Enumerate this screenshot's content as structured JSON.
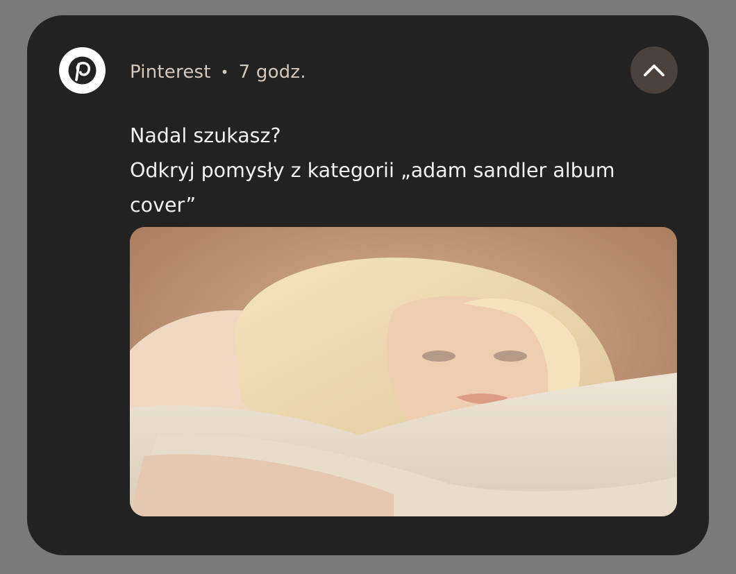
{
  "notification": {
    "app_name": "Pinterest",
    "separator": "•",
    "time": "7 godz.",
    "title": "Nadal szukasz?",
    "body": "Odkryj pomysły z kategorii „adam sandler album cover”",
    "icons": {
      "app": "pinterest-logo-icon",
      "collapse": "chevron-up-icon"
    },
    "image": {
      "description": "photo-thumbnail"
    }
  },
  "colors": {
    "background": "#7a7a7a",
    "card": "#222222",
    "header_text": "#d4c7bc",
    "message_text": "#f2f2f2",
    "collapse_button": "#4c423d",
    "pinterest_red": "#e60023"
  }
}
